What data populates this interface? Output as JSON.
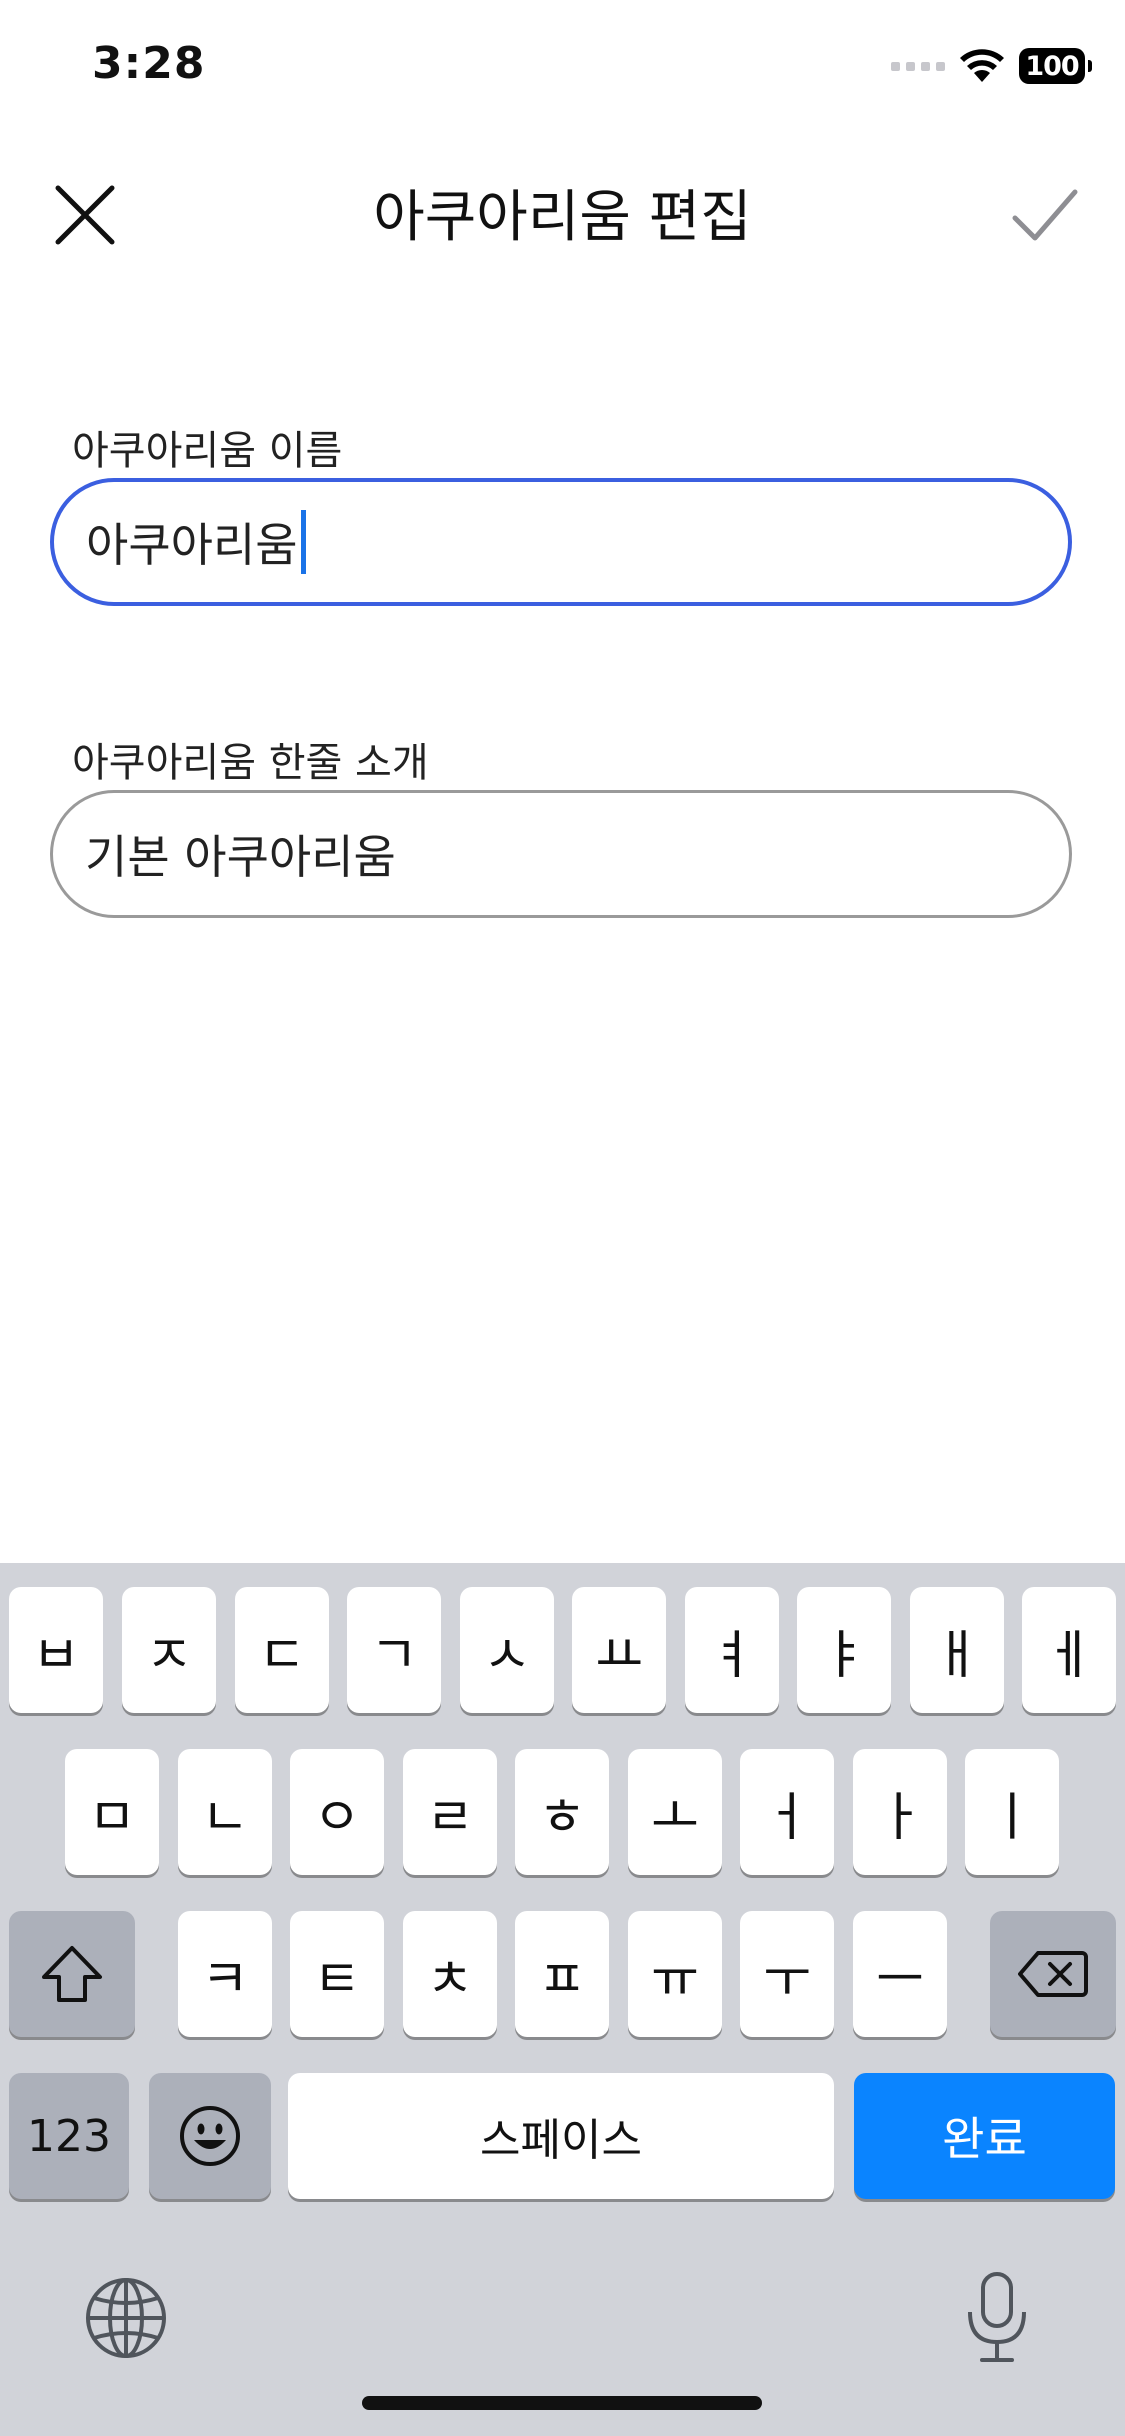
{
  "status_bar": {
    "time": "3:28",
    "battery": "100"
  },
  "header": {
    "title": "아쿠아리움 편집"
  },
  "form": {
    "name_label": "아쿠아리움 이름",
    "name_value": "아쿠아리움",
    "intro_label": "아쿠아리움 한줄 소개",
    "intro_value": "기본 아쿠아리움"
  },
  "keyboard": {
    "row1": [
      "ㅂ",
      "ㅈ",
      "ㄷ",
      "ㄱ",
      "ㅅ",
      "ㅛ",
      "ㅕ",
      "ㅑ",
      "ㅐ",
      "ㅔ"
    ],
    "row2": [
      "ㅁ",
      "ㄴ",
      "ㅇ",
      "ㄹ",
      "ㅎ",
      "ㅗ",
      "ㅓ",
      "ㅏ",
      "ㅣ"
    ],
    "row3": [
      "ㅋ",
      "ㅌ",
      "ㅊ",
      "ㅍ",
      "ㅠ",
      "ㅜ",
      "ㅡ"
    ],
    "numbers_label": "123",
    "space_label": "스페이스",
    "done_label": "완료"
  },
  "colors": {
    "accent": "#3b5fe0",
    "done": "#0a84ff",
    "keyboard_bg": "#d1d3d9"
  }
}
